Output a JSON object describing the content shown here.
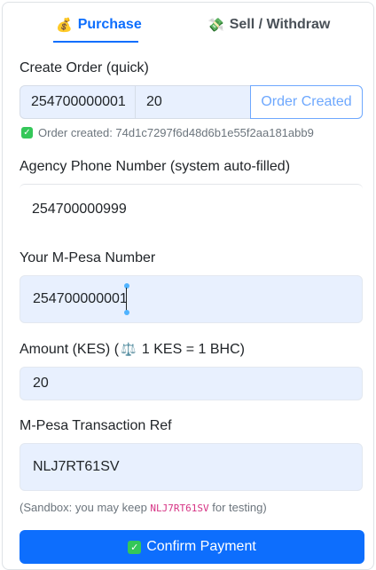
{
  "tabs": {
    "purchase": {
      "icon": "💰",
      "label": "Purchase"
    },
    "sell": {
      "icon": "💸",
      "label": "Sell / Withdraw"
    }
  },
  "quick_order": {
    "label": "Create Order (quick)",
    "phone_value": "254700000001",
    "amount_value": "20",
    "button_label": "Order Created",
    "status_text": "Order created: 74d1c7297f6d48d6b1e55f2aa181abb9"
  },
  "agency_phone": {
    "label": "Agency Phone Number (system auto-filled)",
    "value": "254700000999"
  },
  "mpesa_number": {
    "label": "Your M-Pesa Number",
    "value": "254700000001"
  },
  "amount": {
    "label_prefix": "Amount (KES) (",
    "label_icon": "⚖️",
    "label_suffix": " 1 KES = 1 BHC)",
    "value": "20"
  },
  "tx_ref": {
    "label": "M-Pesa Transaction Ref",
    "value": "NLJ7RT61SV"
  },
  "hint": {
    "prefix": "(Sandbox: you may keep ",
    "code": "NLJ7RT61SV",
    "suffix": " for testing)"
  },
  "confirm": {
    "label": "Confirm Payment"
  },
  "colors": {
    "accent": "#0d6efd",
    "success": "#34c759",
    "code": "#d63384"
  }
}
